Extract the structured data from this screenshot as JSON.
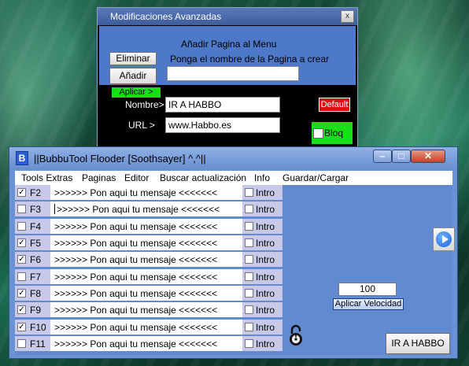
{
  "dialog": {
    "title": "Modificaciones Avanzadas",
    "close_glyph": "x",
    "heading": "Añadir Pagina al Menu",
    "prompt": "Ponga el nombre de la Pagina a crear",
    "eliminar_label": "Eliminar",
    "anadir_label": "Añadir",
    "page_name_value": "",
    "aplicar_label": "Aplicar >",
    "nombre_label": "Nombre>",
    "nombre_value": "IR A HABBO",
    "url_label": "URL >",
    "url_value": "www.Habbo.es",
    "default_label": "Default",
    "bloq_label": "Bloq",
    "bloq_checked": false
  },
  "window": {
    "title": "||BubbuTool Flooder [Soothsayer] ^,^||",
    "icon": "B",
    "controls": {
      "minimize": "–",
      "maximize": "□",
      "close": "✕"
    }
  },
  "menu": [
    "Tools Extras",
    "Paginas",
    "Editor",
    "Buscar actualización",
    "Info",
    "Guardar/Cargar"
  ],
  "rows": [
    {
      "key": "F2",
      "checked": true,
      "message": ">>>>>> Pon aqui tu mensaje <<<<<<<",
      "intro_label": "Intro",
      "intro_checked": false
    },
    {
      "key": "F3",
      "checked": false,
      "message": ">>>>>> Pon aqui tu mensaje <<<<<<<",
      "intro_label": "Intro",
      "intro_checked": false
    },
    {
      "key": "F4",
      "checked": false,
      "message": ">>>>>> Pon aqui tu mensaje <<<<<<<",
      "intro_label": "Intro",
      "intro_checked": false
    },
    {
      "key": "F5",
      "checked": true,
      "message": ">>>>>> Pon aqui tu mensaje <<<<<<<",
      "intro_label": "Intro",
      "intro_checked": false
    },
    {
      "key": "F6",
      "checked": true,
      "message": ">>>>>> Pon aqui tu mensaje <<<<<<<",
      "intro_label": "Intro",
      "intro_checked": false
    },
    {
      "key": "F7",
      "checked": false,
      "message": ">>>>>> Pon aqui tu mensaje <<<<<<<",
      "intro_label": "Intro",
      "intro_checked": false
    },
    {
      "key": "F8",
      "checked": true,
      "message": ">>>>>> Pon aqui tu mensaje <<<<<<<",
      "intro_label": "Intro",
      "intro_checked": false
    },
    {
      "key": "F9",
      "checked": true,
      "message": ">>>>>> Pon aqui tu mensaje <<<<<<<",
      "intro_label": "Intro",
      "intro_checked": false
    },
    {
      "key": "F10",
      "checked": true,
      "message": ">>>>>> Pon aqui tu mensaje <<<<<<<",
      "intro_label": "Intro",
      "intro_checked": false
    },
    {
      "key": "F11",
      "checked": false,
      "message": ">>>>>> Pon aqui tu mensaje <<<<<<<",
      "intro_label": "Intro",
      "intro_checked": false
    }
  ],
  "speed": {
    "value": "100",
    "apply_label": "Aplicar Velocidad"
  },
  "ir_habbo_label": "IR A HABBO",
  "icons": {
    "play": "play-icon",
    "lock": "lock-icon",
    "app": "bubbutool-app-icon"
  }
}
